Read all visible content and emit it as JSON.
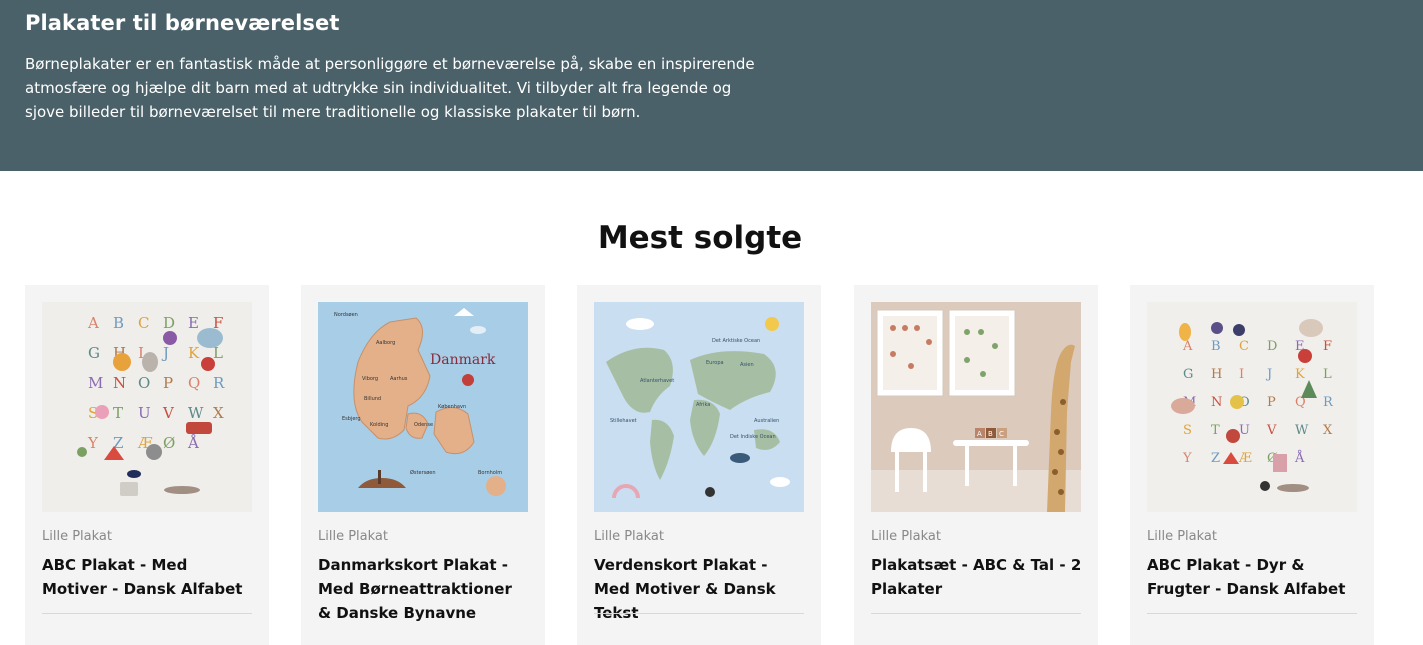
{
  "hero": {
    "title": "Plakater til børneværelset",
    "description": "Børneplakater er en fantastisk måde at personliggøre et børneværelse på, skabe en inspirerende atmosfære og hjælpe dit barn med at udtrykke sin individualitet. Vi tilbyder alt fra legende og sjove billeder til børneværelset til mere traditionelle og klassiske plakater til børn."
  },
  "bestsellers": {
    "heading": "Mest solgte",
    "products": [
      {
        "vendor": "Lille Plakat",
        "title": "ABC Plakat - Med Motiver - Dansk Alfabet"
      },
      {
        "vendor": "Lille Plakat",
        "title": "Danmarkskort Plakat - Med Børneattraktioner & Danske Bynavne"
      },
      {
        "vendor": "Lille Plakat",
        "title": "Verdenskort Plakat - Med Motiver & Dansk Tekst"
      },
      {
        "vendor": "Lille Plakat",
        "title": "Plakatsæt - ABC & Tal - 2 Plakater"
      },
      {
        "vendor": "Lille Plakat",
        "title": "ABC Plakat - Dyr & Frugter - Dansk Alfabet"
      }
    ]
  },
  "poster_art": {
    "abc_letters_1": "ABCDEFGHIJKLMNOPQRSTUVWXYZÆØÅ",
    "abc_letters_2": "ABCDEFGHIJKLMNOPQRSTUVWXYZÆØÅ",
    "denmark_label": "Danmark",
    "denmark_places": [
      "Nordsøen",
      "Aalborg",
      "Viborg",
      "Aarhus",
      "Billund",
      "Odense",
      "Esbjerg",
      "Kolding",
      "København",
      "Bornholm",
      "Østersøen"
    ],
    "world_labels": [
      "Det Arktiske Ocean",
      "Europa",
      "Asien",
      "Afrika",
      "Stillehavet",
      "Atlanterhavet",
      "Det Indiske Ocean",
      "Australien"
    ],
    "abc_blocks": "ABC"
  },
  "colors": {
    "hero_bg": "#4a6169",
    "card_bg": "#f4f4f4"
  }
}
